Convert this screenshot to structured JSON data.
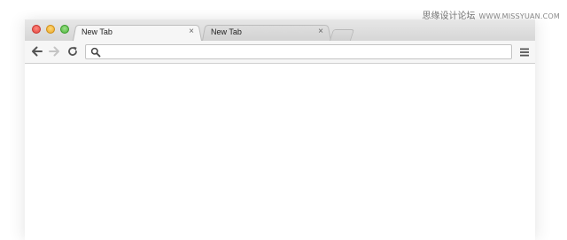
{
  "watermark": {
    "site_name": "思缘设计论坛",
    "site_url": "WWW.MISSYUAN.COM"
  },
  "browser": {
    "tabs": [
      {
        "label": "New Tab",
        "close_glyph": "×",
        "active": true
      },
      {
        "label": "New Tab",
        "close_glyph": "×",
        "active": false
      }
    ],
    "window_controls": [
      "close",
      "minimize",
      "maximize"
    ],
    "toolbar": {
      "back_icon": "arrow-left-icon",
      "forward_icon": "arrow-right-icon",
      "reload_icon": "reload-icon",
      "menu_icon": "hamburger-menu-icon"
    },
    "omnibox": {
      "value": "",
      "icon": "search-icon"
    }
  },
  "colors": {
    "tabstrip": "#dcdcdc",
    "active_tab": "#f6f6f6",
    "toolbar": "#f6f6f6",
    "close_light": "#e0443e",
    "minimize_light": "#e8a623",
    "maximize_light": "#4bb53a"
  }
}
